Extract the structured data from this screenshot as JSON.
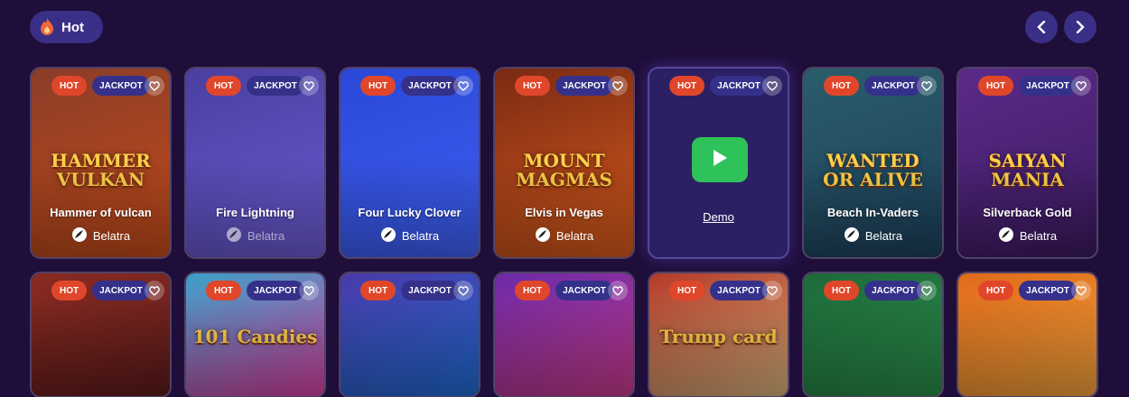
{
  "section": {
    "label": "Hot",
    "icon": "flame-icon"
  },
  "nav": {
    "prev_icon": "chevron-left-icon",
    "next_icon": "chevron-right-icon"
  },
  "badges": {
    "hot": "HOT",
    "jackpot": "JACKPOT"
  },
  "demo_label": "Demo",
  "row1": [
    {
      "title": "Hammer of vulcan",
      "provider": "Belatra",
      "art_text": "HAMMER VULKAN",
      "bg": "#8a3d29",
      "bg2": "#c24a1a"
    },
    {
      "title": "Fire  Lightning",
      "provider": "Belatra",
      "bg": "#4a3fa0",
      "bg2": "#6a5ad0"
    },
    {
      "title": "Four Lucky Clover",
      "provider": "Belatra",
      "bg": "#2b48d8",
      "bg2": "#3e5ff0"
    },
    {
      "title": "Elvis in Vegas",
      "provider": "Belatra",
      "art_text": "MOUNT MAGMAS",
      "bg": "#7a2a14",
      "bg2": "#d65a1c"
    },
    {
      "title": "",
      "provider": "",
      "bg": "#2c1f63",
      "bg2": "#2c1f63"
    },
    {
      "title": "Beach In-Vaders",
      "provider": "Belatra",
      "art_text": "WANTED OR ALIVE",
      "bg": "#2a5d6b",
      "bg2": "#1c3f5a"
    },
    {
      "title": "Silverback Gold",
      "provider": "Belatra",
      "art_text": "SAIYAN MANIA",
      "bg": "#5b2a8a",
      "bg2": "#3a1a5e"
    }
  ],
  "row2": [
    {
      "bg": "#8a2b22",
      "bg2": "#5b1a1a"
    },
    {
      "art_text": "101 Candies",
      "bg": "#3aa0c8",
      "bg2": "#d83ea0"
    },
    {
      "bg": "#4a3aa8",
      "bg2": "#1f6ad0"
    },
    {
      "bg": "#6b2aa8",
      "bg2": "#c83a8a"
    },
    {
      "art_text": "Trump card",
      "bg": "#b33a2a",
      "bg2": "#d6b07a"
    },
    {
      "bg": "#1e6a3a",
      "bg2": "#2a8a4a"
    },
    {
      "bg": "#e06a1a",
      "bg2": "#f0a03a"
    }
  ]
}
